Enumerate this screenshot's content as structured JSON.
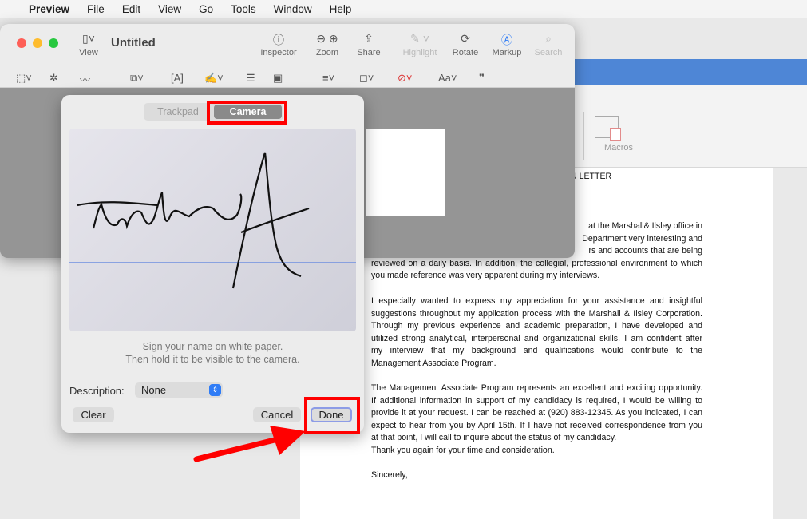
{
  "menubar": {
    "app": "Preview",
    "items": [
      "File",
      "Edit",
      "View",
      "Go",
      "Tools",
      "Window",
      "Help"
    ]
  },
  "preview": {
    "title": "Untitled",
    "view_label": "View",
    "toolbar": [
      {
        "label": "Inspector",
        "icon": "info-icon"
      },
      {
        "label": "Zoom",
        "icon": "zoom-icon"
      },
      {
        "label": "Share",
        "icon": "share-icon"
      },
      {
        "label": "Highlight",
        "icon": "highlight-icon"
      },
      {
        "label": "Rotate",
        "icon": "rotate-icon"
      },
      {
        "label": "Markup",
        "icon": "markup-icon"
      },
      {
        "label": "Search",
        "icon": "search-icon"
      }
    ],
    "markup_text_label": "Aa"
  },
  "signature_panel": {
    "tabs": [
      "Trackpad",
      "Camera"
    ],
    "selected_tab": "Camera",
    "hint_line1": "Sign your name on white paper.",
    "hint_line2": "Then hold it to be visible to the camera.",
    "description_label": "Description:",
    "description_value": "None",
    "clear": "Clear",
    "cancel": "Cancel",
    "done": "Done"
  },
  "word": {
    "macros_label": "Macros",
    "accent": "#4e86d6"
  },
  "document": {
    "heading": "U LETTER",
    "p1_frags": [
      "at the Marshall& Ilsley office in",
      "Department very interesting and",
      "rs and accounts that are being"
    ],
    "p1": [
      "reviewed on a daily basis. In addition, the collegial, professional environment to which",
      "you made reference was very apparent during my interviews."
    ],
    "p2": [
      "I especially wanted to express my appreciation for your assistance and insightful",
      "suggestions throughout my application process with the Marshall & Ilsley Corporation.",
      "Through my previous experience and academic preparation, I have developed and",
      "utilized strong analytical, interpersonal and organizational skills. I am confident after",
      "my interview that my background and qualifications would contribute to the",
      "Management Associate Program."
    ],
    "p3": [
      "The Management Associate Program represents an excellent and exciting opportunity.",
      "If additional information in support of my candidacy is required, I would be willing to",
      "provide it at your request. I can be reached at (920) 883-12345. As you indicated, I can",
      "expect to hear from you by April 15th. If I have not received correspondence from you",
      "at that point, I will call to inquire about the status of my candidacy.",
      "Thank you again for your time and consideration."
    ],
    "closing": "Sincerely,"
  },
  "annotation_color": "#ff0000"
}
